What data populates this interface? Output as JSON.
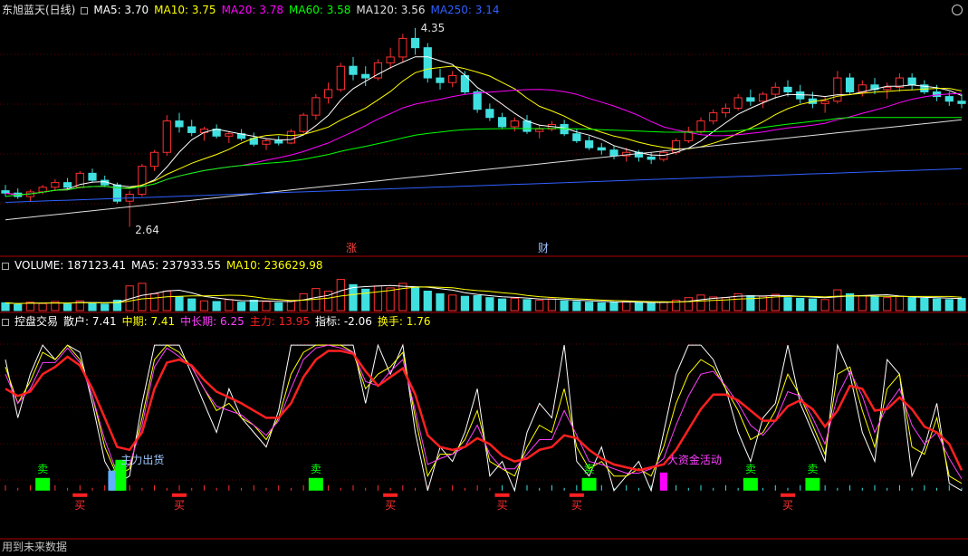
{
  "header": {
    "stock": "东旭蓝天(日线)",
    "ma_labels": [
      {
        "text": "MA5: 3.70",
        "color": "#ffffff"
      },
      {
        "text": "MA10: 3.75",
        "color": "#ffff00"
      },
      {
        "text": "MA20: 3.78",
        "color": "#ff00ff"
      },
      {
        "text": "MA60: 3.58",
        "color": "#00ff00"
      },
      {
        "text": "MA120: 3.56",
        "color": "#e0e0e0"
      },
      {
        "text": "MA250: 3.14",
        "color": "#3060ff"
      }
    ]
  },
  "price_panel": {
    "high_marker": "4.35",
    "low_marker": "2.64",
    "events": [
      {
        "text": "涨",
        "color": "#ff4040"
      },
      {
        "text": "财",
        "color": "#a0c0ff"
      }
    ]
  },
  "volume_panel": {
    "labels": [
      {
        "text": "VOLUME: 187123.41",
        "color": "#ffffff"
      },
      {
        "text": "MA5: 237933.55",
        "color": "#ffffff"
      },
      {
        "text": "MA10: 236629.98",
        "color": "#ffff00"
      }
    ]
  },
  "indicator_panel": {
    "labels": [
      {
        "text": "控盘交易",
        "color": "#ffffff"
      },
      {
        "text": "散户: 7.41",
        "color": "#ffffff"
      },
      {
        "text": "中期: 7.41",
        "color": "#ffff00"
      },
      {
        "text": "中长期: 6.25",
        "color": "#ff40ff"
      },
      {
        "text": "主力: 13.95",
        "color": "#ff2020"
      },
      {
        "text": "指标: -2.06",
        "color": "#ffffff"
      },
      {
        "text": "换手: 1.76",
        "color": "#ffff00"
      }
    ],
    "sell_labels": [
      "卖",
      "卖",
      "卖",
      "卖",
      "卖",
      "卖"
    ],
    "buy_labels": [
      "买",
      "买",
      "买",
      "买",
      "买",
      "买"
    ],
    "annotations": [
      {
        "text": "主力出货",
        "color": "#a0c8ff"
      },
      {
        "text": "大资金活动",
        "color": "#ff40ff"
      }
    ]
  },
  "footer": "用到未来数据",
  "chart_data": {
    "type": "candlestick",
    "price_range": [
      2.55,
      4.45
    ],
    "candles": [
      [
        2.95,
        3.0,
        2.9,
        2.93
      ],
      [
        2.93,
        2.97,
        2.88,
        2.9
      ],
      [
        2.9,
        2.96,
        2.86,
        2.94
      ],
      [
        2.94,
        3.0,
        2.92,
        2.98
      ],
      [
        2.98,
        3.05,
        2.95,
        3.02
      ],
      [
        3.02,
        3.06,
        2.96,
        2.98
      ],
      [
        2.98,
        3.12,
        2.97,
        3.1
      ],
      [
        3.1,
        3.14,
        3.02,
        3.04
      ],
      [
        3.04,
        3.08,
        2.98,
        3.0
      ],
      [
        3.0,
        3.02,
        2.84,
        2.86
      ],
      [
        2.86,
        2.95,
        2.64,
        2.92
      ],
      [
        2.92,
        3.18,
        2.9,
        3.16
      ],
      [
        3.16,
        3.3,
        3.12,
        3.28
      ],
      [
        3.28,
        3.6,
        3.25,
        3.55
      ],
      [
        3.55,
        3.62,
        3.45,
        3.5
      ],
      [
        3.5,
        3.56,
        3.42,
        3.45
      ],
      [
        3.45,
        3.5,
        3.38,
        3.48
      ],
      [
        3.48,
        3.52,
        3.4,
        3.42
      ],
      [
        3.42,
        3.46,
        3.36,
        3.44
      ],
      [
        3.44,
        3.48,
        3.38,
        3.4
      ],
      [
        3.4,
        3.45,
        3.33,
        3.35
      ],
      [
        3.35,
        3.4,
        3.3,
        3.38
      ],
      [
        3.38,
        3.42,
        3.34,
        3.36
      ],
      [
        3.36,
        3.48,
        3.35,
        3.46
      ],
      [
        3.46,
        3.62,
        3.44,
        3.6
      ],
      [
        3.6,
        3.78,
        3.56,
        3.75
      ],
      [
        3.75,
        3.88,
        3.7,
        3.82
      ],
      [
        3.82,
        4.05,
        3.8,
        4.02
      ],
      [
        4.02,
        4.1,
        3.9,
        3.95
      ],
      [
        3.95,
        4.02,
        3.85,
        3.92
      ],
      [
        3.92,
        4.08,
        3.9,
        4.05
      ],
      [
        4.05,
        4.18,
        4.0,
        4.1
      ],
      [
        4.1,
        4.3,
        4.05,
        4.26
      ],
      [
        4.26,
        4.35,
        4.12,
        4.18
      ],
      [
        4.18,
        4.22,
        3.88,
        3.92
      ],
      [
        3.92,
        4.0,
        3.82,
        3.88
      ],
      [
        3.88,
        3.98,
        3.84,
        3.94
      ],
      [
        3.94,
        3.98,
        3.78,
        3.8
      ],
      [
        3.8,
        3.82,
        3.62,
        3.65
      ],
      [
        3.65,
        3.7,
        3.55,
        3.58
      ],
      [
        3.58,
        3.62,
        3.48,
        3.5
      ],
      [
        3.5,
        3.58,
        3.46,
        3.55
      ],
      [
        3.55,
        3.6,
        3.44,
        3.46
      ],
      [
        3.46,
        3.52,
        3.4,
        3.48
      ],
      [
        3.48,
        3.55,
        3.46,
        3.52
      ],
      [
        3.52,
        3.56,
        3.42,
        3.44
      ],
      [
        3.44,
        3.48,
        3.36,
        3.38
      ],
      [
        3.38,
        3.42,
        3.3,
        3.32
      ],
      [
        3.32,
        3.36,
        3.26,
        3.3
      ],
      [
        3.3,
        3.34,
        3.22,
        3.25
      ],
      [
        3.25,
        3.32,
        3.2,
        3.28
      ],
      [
        3.28,
        3.3,
        3.2,
        3.24
      ],
      [
        3.24,
        3.28,
        3.18,
        3.22
      ],
      [
        3.22,
        3.3,
        3.2,
        3.28
      ],
      [
        3.28,
        3.4,
        3.26,
        3.38
      ],
      [
        3.38,
        3.5,
        3.36,
        3.46
      ],
      [
        3.46,
        3.58,
        3.44,
        3.55
      ],
      [
        3.55,
        3.65,
        3.52,
        3.62
      ],
      [
        3.62,
        3.7,
        3.58,
        3.66
      ],
      [
        3.66,
        3.78,
        3.64,
        3.75
      ],
      [
        3.75,
        3.82,
        3.68,
        3.72
      ],
      [
        3.72,
        3.8,
        3.66,
        3.78
      ],
      [
        3.78,
        3.88,
        3.74,
        3.84
      ],
      [
        3.84,
        3.9,
        3.76,
        3.8
      ],
      [
        3.8,
        3.86,
        3.7,
        3.74
      ],
      [
        3.74,
        3.8,
        3.66,
        3.7
      ],
      [
        3.7,
        3.76,
        3.62,
        3.72
      ],
      [
        3.72,
        3.98,
        3.7,
        3.92
      ],
      [
        3.92,
        3.96,
        3.78,
        3.8
      ],
      [
        3.8,
        3.9,
        3.76,
        3.86
      ],
      [
        3.86,
        3.92,
        3.78,
        3.82
      ],
      [
        3.82,
        3.88,
        3.74,
        3.84
      ],
      [
        3.84,
        3.96,
        3.8,
        3.92
      ],
      [
        3.92,
        3.96,
        3.82,
        3.86
      ],
      [
        3.86,
        3.9,
        3.78,
        3.8
      ],
      [
        3.8,
        3.86,
        3.72,
        3.76
      ],
      [
        3.76,
        3.8,
        3.68,
        3.72
      ],
      [
        3.72,
        3.78,
        3.66,
        3.7
      ]
    ],
    "volume_range": [
      0,
      600000
    ],
    "volumes": [
      120000,
      95000,
      130000,
      110000,
      140000,
      100000,
      150000,
      120000,
      100000,
      160000,
      380000,
      420000,
      260000,
      300000,
      210000,
      180000,
      150000,
      140000,
      170000,
      130000,
      160000,
      140000,
      120000,
      150000,
      260000,
      340000,
      300000,
      480000,
      400000,
      330000,
      380000,
      350000,
      420000,
      360000,
      300000,
      260000,
      240000,
      220000,
      230000,
      200000,
      180000,
      190000,
      170000,
      160000,
      180000,
      150000,
      140000,
      130000,
      120000,
      130000,
      140000,
      120000,
      110000,
      130000,
      160000,
      200000,
      240000,
      210000,
      200000,
      260000,
      230000,
      220000,
      250000,
      200000,
      190000,
      180000,
      170000,
      320000,
      260000,
      230000,
      210000,
      200000,
      220000,
      200000,
      190000,
      180000,
      170000,
      187123
    ],
    "indicator_range": [
      -30,
      110
    ],
    "retail": [
      90,
      50,
      80,
      100,
      90,
      100,
      95,
      60,
      20,
      5,
      10,
      60,
      100,
      100,
      100,
      80,
      60,
      40,
      70,
      50,
      40,
      30,
      55,
      100,
      100,
      100,
      100,
      100,
      100,
      60,
      100,
      80,
      100,
      40,
      0,
      30,
      20,
      40,
      70,
      10,
      20,
      0,
      40,
      60,
      50,
      100,
      20,
      10,
      30,
      0,
      10,
      20,
      0,
      40,
      80,
      100,
      100,
      90,
      70,
      40,
      20,
      50,
      60,
      100,
      60,
      40,
      20,
      100,
      80,
      40,
      20,
      90,
      80,
      10,
      30,
      60,
      5,
      0
    ],
    "mid": [
      85,
      60,
      75,
      95,
      90,
      100,
      90,
      65,
      30,
      10,
      15,
      50,
      90,
      100,
      95,
      85,
      70,
      55,
      60,
      50,
      45,
      35,
      50,
      80,
      95,
      100,
      100,
      100,
      95,
      70,
      80,
      85,
      95,
      50,
      10,
      25,
      25,
      35,
      55,
      20,
      15,
      10,
      30,
      45,
      40,
      70,
      30,
      15,
      20,
      10,
      10,
      15,
      10,
      30,
      60,
      80,
      90,
      85,
      70,
      55,
      35,
      40,
      55,
      80,
      65,
      45,
      25,
      80,
      85,
      55,
      30,
      70,
      80,
      30,
      25,
      50,
      10,
      5
    ],
    "long": [
      80,
      60,
      70,
      88,
      88,
      98,
      88,
      65,
      35,
      12,
      18,
      45,
      85,
      98,
      92,
      85,
      70,
      58,
      55,
      52,
      45,
      38,
      48,
      70,
      90,
      98,
      100,
      98,
      95,
      75,
      72,
      82,
      90,
      55,
      18,
      22,
      25,
      30,
      45,
      25,
      15,
      15,
      25,
      35,
      35,
      55,
      38,
      20,
      18,
      15,
      12,
      12,
      15,
      22,
      45,
      65,
      80,
      82,
      72,
      60,
      45,
      38,
      48,
      68,
      65,
      50,
      32,
      65,
      82,
      65,
      40,
      58,
      70,
      45,
      32,
      40,
      22,
      8
    ],
    "main": [
      70,
      65,
      68,
      80,
      85,
      92,
      86,
      70,
      50,
      30,
      28,
      40,
      70,
      88,
      90,
      86,
      76,
      68,
      64,
      60,
      55,
      50,
      50,
      60,
      78,
      90,
      96,
      96,
      94,
      82,
      72,
      78,
      84,
      66,
      38,
      30,
      28,
      30,
      36,
      32,
      24,
      20,
      22,
      28,
      30,
      38,
      36,
      28,
      22,
      18,
      16,
      14,
      16,
      18,
      28,
      42,
      56,
      66,
      66,
      62,
      55,
      48,
      48,
      58,
      62,
      56,
      44,
      55,
      72,
      70,
      55,
      56,
      64,
      56,
      44,
      40,
      32,
      14
    ],
    "sell_idx": [
      3,
      9,
      25,
      47,
      60,
      65
    ],
    "buy_idx": [
      6,
      14,
      31,
      40,
      46,
      63
    ],
    "annot_idx": [
      9,
      53
    ]
  }
}
